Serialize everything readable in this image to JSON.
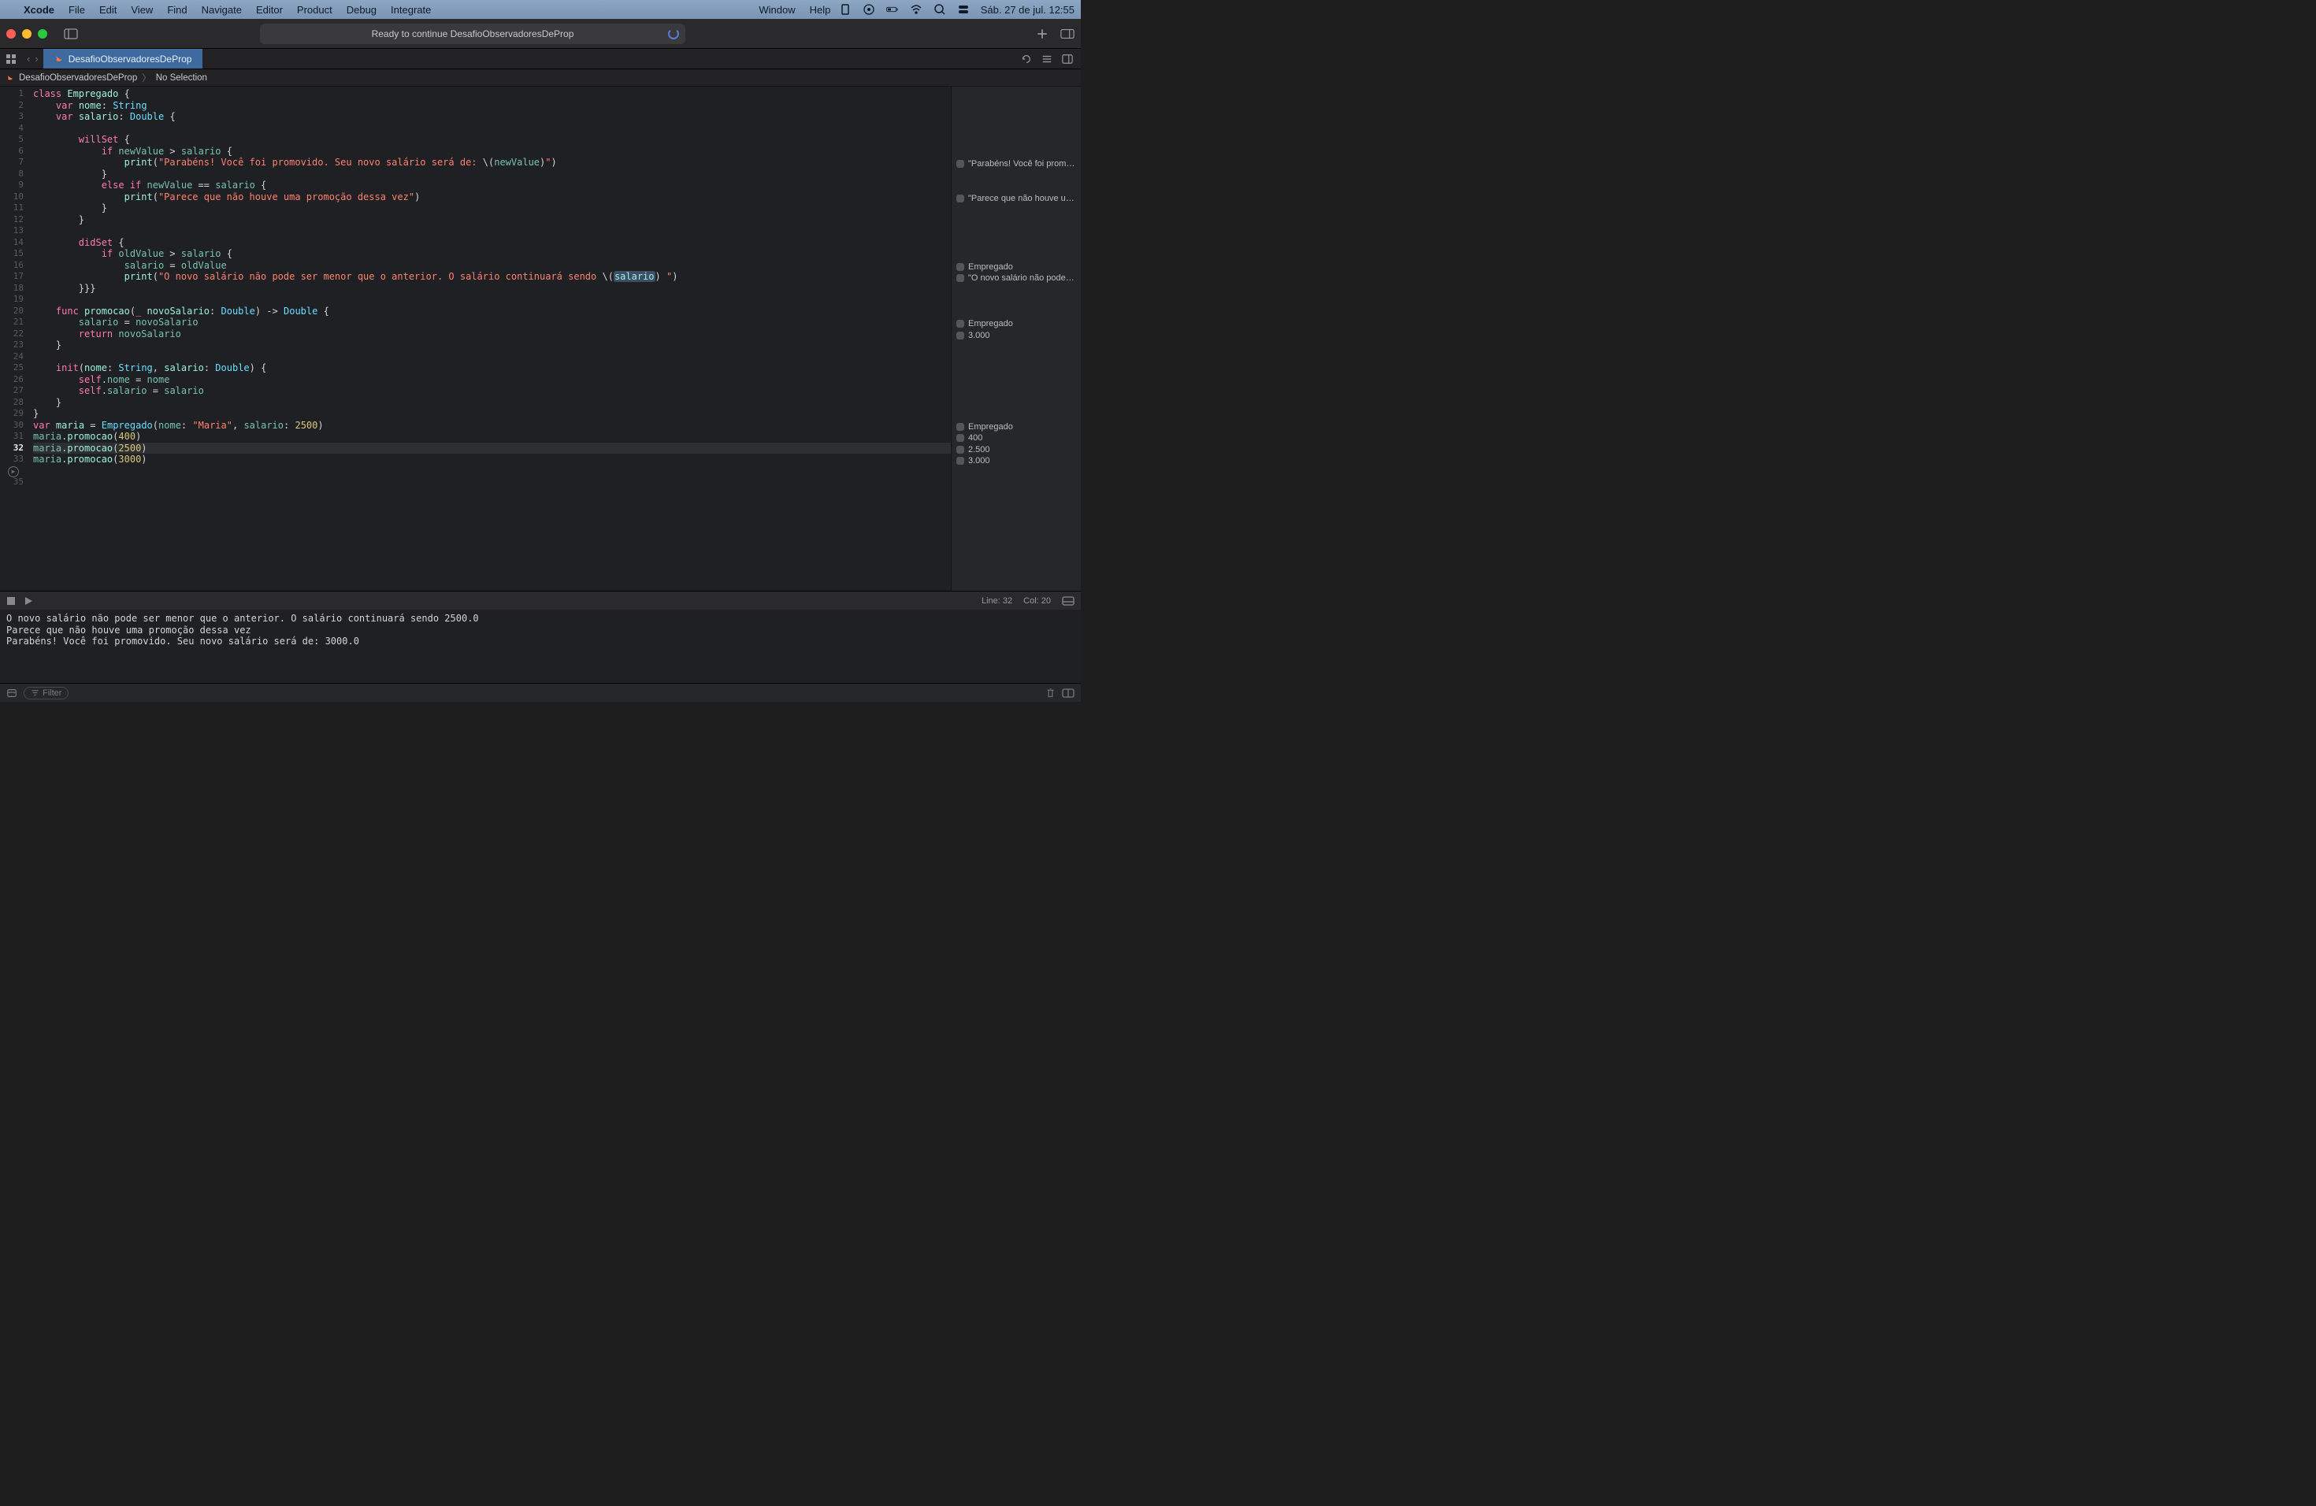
{
  "menubar": {
    "app": "Xcode",
    "items": [
      "File",
      "Edit",
      "View",
      "Find",
      "Navigate",
      "Editor",
      "Product",
      "Debug",
      "Integrate",
      "Window",
      "Help"
    ],
    "clock": "Sáb. 27 de jul.  12:55"
  },
  "toolbar": {
    "status": "Ready to continue DesafioObservadoresDeProp"
  },
  "tab": {
    "title": "DesafioObservadoresDeProp"
  },
  "breadcrumb": {
    "file": "DesafioObservadoresDeProp",
    "selection": "No Selection"
  },
  "code": {
    "className": "Empregado",
    "var_nome": "nome",
    "type_string": "String",
    "var_salario": "salario",
    "type_double": "Double",
    "willSet": "willSet",
    "didSet": "didSet",
    "newValue": "newValue",
    "oldValue": "oldValue",
    "str_parabens": "\"Parabéns! Você foi promovido. Seu novo salário será de: ",
    "str_parece": "\"Parece que não houve uma promoção dessa vez\"",
    "str_novo": "\"O novo salário não pode ser menor que o anterior. O salário continuará sendo ",
    "func_promocao": "promocao",
    "param_novoSalario": "novoSalario",
    "init": "init",
    "maria": "maria",
    "maria_str": "\"Maria\"",
    "num_2500": "2500",
    "num_400": "400",
    "num_3000": "3000"
  },
  "minimap": {
    "items": [
      {
        "row": 7,
        "text": "\"Parabéns! Você foi prom…"
      },
      {
        "row": 10,
        "text": "\"Parece que não houve u…"
      },
      {
        "row": 16,
        "text": "Empregado"
      },
      {
        "row": 17,
        "text": "\"O novo salário não pode…"
      },
      {
        "row": 21,
        "text": "Empregado"
      },
      {
        "row": 22,
        "text": "3.000"
      },
      {
        "row": 30,
        "text": "Empregado"
      },
      {
        "row": 31,
        "text": "400"
      },
      {
        "row": 32,
        "text": "2.500"
      },
      {
        "row": 33,
        "text": "3.000"
      }
    ]
  },
  "debugbar": {
    "line": "Line: 32",
    "col": "Col: 20"
  },
  "console": {
    "lines": [
      "O novo salário não pode ser menor que o anterior. O salário continuará sendo 2500.0",
      "Parece que não houve uma promoção dessa vez",
      "Parabéns! Você foi promovido. Seu novo salário será de: 3000.0"
    ]
  },
  "filter": {
    "placeholder": "Filter"
  },
  "currentLine": 32
}
